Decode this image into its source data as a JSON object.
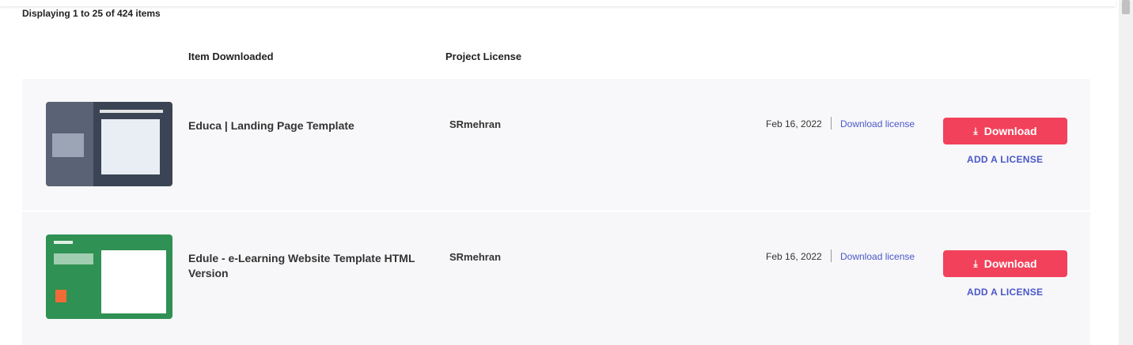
{
  "list": {
    "display_count": "Displaying 1 to 25 of 424 items",
    "col_item": "Item Downloaded",
    "col_license": "Project License"
  },
  "items": [
    {
      "name": "Educa | Landing Page Template",
      "author": "SRmehran",
      "date": "Feb 16, 2022",
      "download_license": "Download license",
      "download_label": "Download",
      "add_license": "ADD A LICENSE"
    },
    {
      "name": "Edule - e-Learning Website Template HTML Version",
      "author": "SRmehran",
      "date": "Feb 16, 2022",
      "download_license": "Download license",
      "download_label": "Download",
      "add_license": "ADD A LICENSE"
    }
  ],
  "colors": {
    "download_button": "#f2415a",
    "link": "#4a57c7"
  },
  "icons": {
    "download": "download-arrow-icon"
  }
}
